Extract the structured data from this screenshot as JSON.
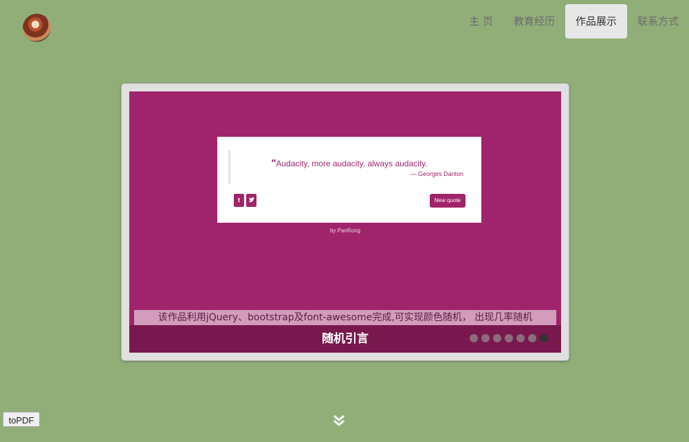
{
  "nav": {
    "items": [
      {
        "label": "主 页",
        "active": false
      },
      {
        "label": "教育经历",
        "active": false
      },
      {
        "label": "作品展示",
        "active": true
      },
      {
        "label": "联系方式",
        "active": false
      }
    ]
  },
  "slide": {
    "preview": {
      "quote_mark": "\"",
      "quote": "Audacity, more audacity, always audacity.",
      "author": "— Georges Danton",
      "tumblr_label": "t",
      "twitter_label": "✦",
      "new_quote_label": "New quote",
      "byline": "by PanRong"
    },
    "description": "该作品利用jQuery、bootstrap及font-awesome完成,可实现颜色随机， 出现几率随机",
    "title": "随机引言",
    "indicator": {
      "count": 7,
      "active_index": 6
    }
  },
  "toolbar": {
    "topdf_label": "toPDF"
  },
  "icons": {
    "scroll_down": "double-chevron-down-icon"
  },
  "colors": {
    "background": "#91ae79",
    "slide": "#a0246b",
    "nav_active": "#e7e7e7"
  }
}
